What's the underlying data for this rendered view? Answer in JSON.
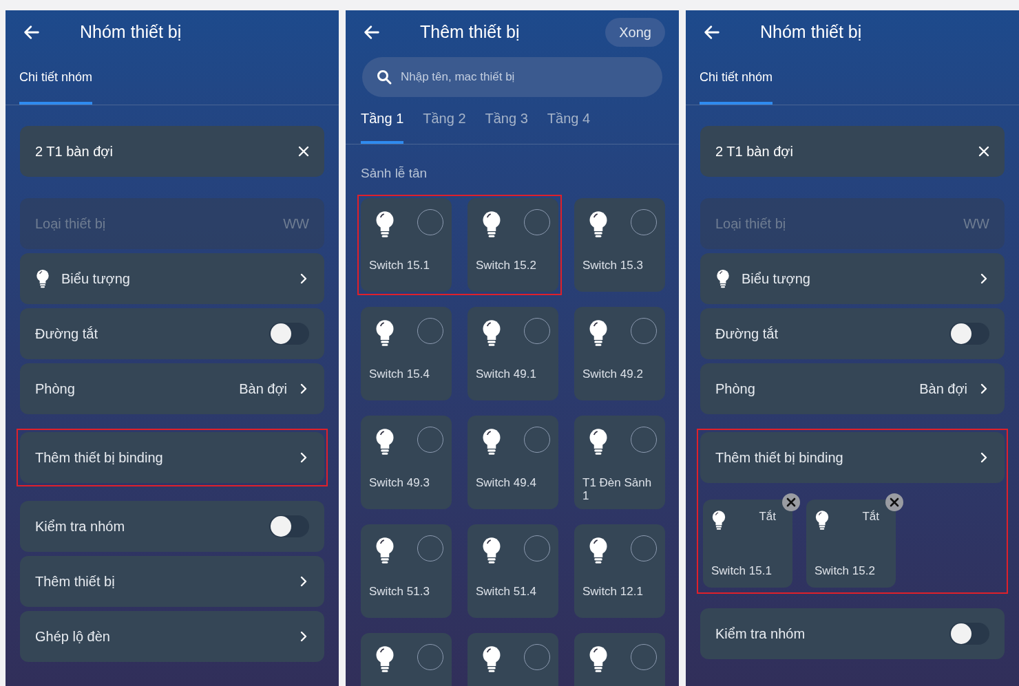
{
  "screens": [
    {
      "kind": "group",
      "title": "Nhóm thiết bị",
      "tabs": [
        {
          "label": "Chi tiết nhóm",
          "selected": true
        }
      ],
      "name_field": {
        "value": "2 T1 bàn đợi"
      },
      "sections": [
        {
          "highlighted": false,
          "rows": [
            {
              "kind": "disabled",
              "label": "Loại thiết bị",
              "value": "WW"
            },
            {
              "kind": "link",
              "label": "Biểu tượng",
              "icon": true
            },
            {
              "kind": "toggle",
              "label": "Đường tắt",
              "on": false
            },
            {
              "kind": "link",
              "label": "Phòng",
              "value": "Bàn đợi"
            }
          ]
        },
        {
          "highlighted": true,
          "rows": [
            {
              "kind": "link",
              "label": "Thêm thiết bị binding"
            }
          ]
        },
        {
          "highlighted": false,
          "rows": [
            {
              "kind": "toggle",
              "label": "Kiểm tra nhóm",
              "on": false
            },
            {
              "kind": "link",
              "label": "Thêm thiết bị"
            },
            {
              "kind": "link",
              "label": "Ghép lộ đèn"
            }
          ]
        }
      ]
    },
    {
      "kind": "picker",
      "title": "Thêm thiết bị",
      "done": "Xong",
      "search": {
        "placeholder": "Nhập tên, mac thiết bị"
      },
      "tabs": [
        {
          "label": "Tầng 1",
          "selected": true
        },
        {
          "label": "Tầng 2",
          "selected": false
        },
        {
          "label": "Tầng 3",
          "selected": false
        },
        {
          "label": "Tầng 4",
          "selected": false
        }
      ],
      "section": "Sảnh lễ tân",
      "tiles": [
        {
          "name": "Switch 15.1",
          "checked": false,
          "highlighted": true
        },
        {
          "name": "Switch 15.2",
          "checked": false,
          "highlighted": true
        },
        {
          "name": "Switch 15.3",
          "checked": false,
          "highlighted": false
        },
        {
          "name": "Switch 15.4",
          "checked": false,
          "highlighted": false
        },
        {
          "name": "Switch 49.1",
          "checked": false,
          "highlighted": false
        },
        {
          "name": "Switch 49.2",
          "checked": false,
          "highlighted": false
        },
        {
          "name": "Switch 49.3",
          "checked": false,
          "highlighted": false
        },
        {
          "name": "Switch 49.4",
          "checked": false,
          "highlighted": false
        },
        {
          "name": "T1 Đèn Sảnh 1",
          "checked": false,
          "highlighted": false
        },
        {
          "name": "Switch 51.3",
          "checked": false,
          "highlighted": false
        },
        {
          "name": "Switch 51.4",
          "checked": false,
          "highlighted": false
        },
        {
          "name": "Switch 12.1",
          "checked": false,
          "highlighted": false
        },
        {
          "checked": false,
          "highlighted": false
        },
        {
          "checked": false,
          "highlighted": false
        },
        {
          "checked": false,
          "highlighted": false
        }
      ]
    },
    {
      "kind": "group",
      "title": "Nhóm thiết bị",
      "tabs": [
        {
          "label": "Chi tiết nhóm",
          "selected": true
        }
      ],
      "name_field": {
        "value": "2 T1 bàn đợi"
      },
      "sections": [
        {
          "highlighted": false,
          "rows": [
            {
              "kind": "disabled",
              "label": "Loại thiết bị",
              "value": "WW"
            },
            {
              "kind": "link",
              "label": "Biểu tượng",
              "icon": true
            },
            {
              "kind": "toggle",
              "label": "Đường tắt",
              "on": false
            },
            {
              "kind": "link",
              "label": "Phòng",
              "value": "Bàn đợi"
            }
          ]
        },
        {
          "highlighted": true,
          "rows": [
            {
              "kind": "link",
              "label": "Thêm thiết bị binding",
              "devices": [
                {
                  "name": "Switch 15.1",
                  "state": "Tắt"
                },
                {
                  "name": "Switch 15.2",
                  "state": "Tắt"
                }
              ]
            }
          ]
        },
        {
          "highlighted": false,
          "rows": [
            {
              "kind": "toggle",
              "label": "Kiểm tra nhóm",
              "on": false
            }
          ]
        }
      ]
    }
  ]
}
